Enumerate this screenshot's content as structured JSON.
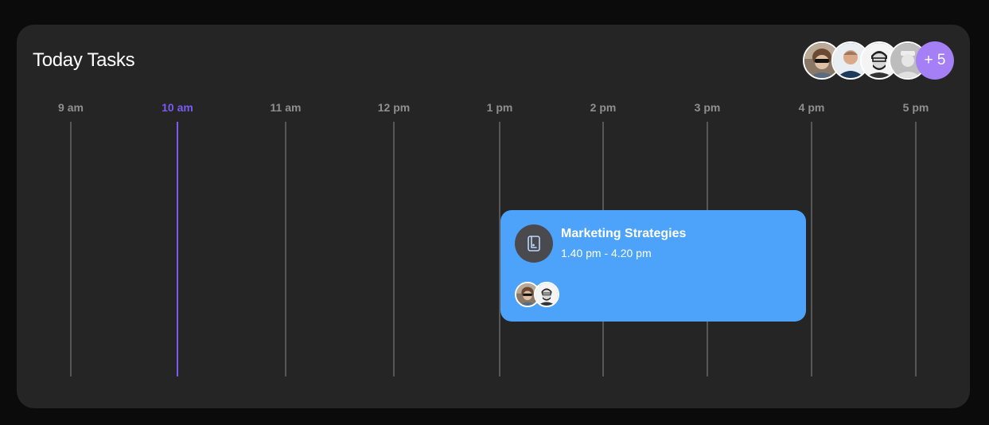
{
  "header": {
    "title": "Today Tasks",
    "more_count": "+ 5"
  },
  "timeline": {
    "hours": [
      "9 am",
      "10 am",
      "11 am",
      "12 pm",
      "1 pm",
      "2 pm",
      "3 pm",
      "4 pm",
      "5 pm"
    ],
    "current_hour": "10 am"
  },
  "task": {
    "title": "Marketing Strategies",
    "time": "1.40 pm - 4.20 pm",
    "icon": "tablet-icon"
  },
  "colors": {
    "accent": "#7a5cf0",
    "task_bg": "#4da3fa",
    "badge": "#a57ff5",
    "card_bg": "#252525"
  }
}
